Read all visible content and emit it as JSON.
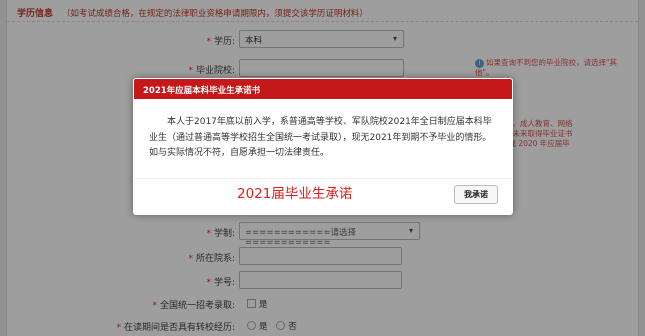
{
  "section": {
    "title": "学历信息",
    "note": "（如考试成绩合格，在规定的法律职业资格申请期限内，须提交该学历证明材料）"
  },
  "fields": {
    "education": {
      "label": "学历:",
      "value": "本科"
    },
    "school": {
      "label": "毕业院校:",
      "value": ""
    },
    "school_hint": "如果查询不到您的毕业院校，请选择\"其他\"。",
    "bg_hint_line1": "，电视大学、成人教育、网络",
    "bg_hint_line2": "须在成学业未来取得毕业证书",
    "bg_hint_line3": "持\"已毕业或 2020 年应届毕",
    "schooling": {
      "label": "学制:",
      "placeholder": "============请选择============"
    },
    "faculty": {
      "label": "所在院系:",
      "value": ""
    },
    "student_no": {
      "label": "学号:",
      "value": ""
    },
    "unified_exam": {
      "label": "全国统一招考录取:",
      "option": "是"
    },
    "transfer": {
      "label": "在读期间是否具有转校经历:",
      "option_yes": "是",
      "option_no": "否"
    }
  },
  "modal": {
    "title": "2021年应届本科毕业生承诺书",
    "body": "本人于2017年底以前入学，系普通高等学校、军队院校2021年全日制应届本科毕业生（通过普通高等学校招生全国统一考试录取），现无2021年到期不予毕业的情形。如与实际情况不符，自愿承担一切法律责任。",
    "caption": "2021届毕业生承诺",
    "button": "我承诺"
  },
  "colors": {
    "accent": "#c4181b",
    "required": "#dd3333"
  }
}
